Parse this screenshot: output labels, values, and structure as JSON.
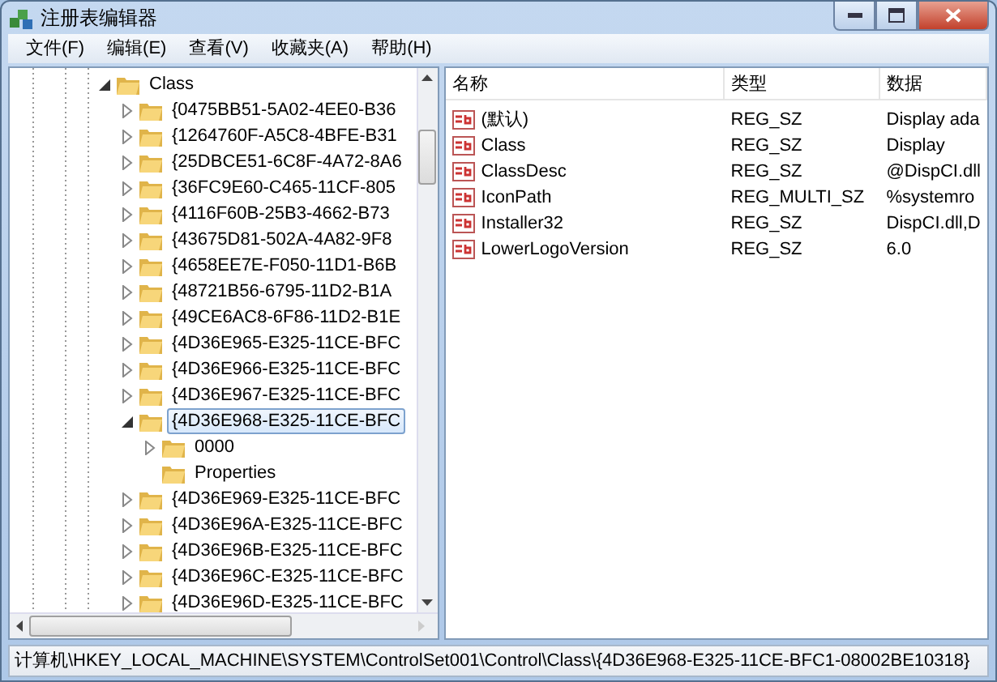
{
  "window": {
    "title": "注册表编辑器"
  },
  "menu": [
    {
      "label": "文件(F)"
    },
    {
      "label": "编辑(E)"
    },
    {
      "label": "查看(V)"
    },
    {
      "label": "收藏夹(A)"
    },
    {
      "label": "帮助(H)"
    }
  ],
  "tree": [
    {
      "label": "Class",
      "expanded": true,
      "selected": false,
      "children": [
        {
          "label": "{0475BB51-5A02-4EE0-B36",
          "expanded": false,
          "selected": false
        },
        {
          "label": "{1264760F-A5C8-4BFE-B31",
          "expanded": false,
          "selected": false
        },
        {
          "label": "{25DBCE51-6C8F-4A72-8A6",
          "expanded": false,
          "selected": false
        },
        {
          "label": "{36FC9E60-C465-11CF-805",
          "expanded": false,
          "selected": false
        },
        {
          "label": "{4116F60B-25B3-4662-B73",
          "expanded": false,
          "selected": false
        },
        {
          "label": "{43675D81-502A-4A82-9F8",
          "expanded": false,
          "selected": false
        },
        {
          "label": "{4658EE7E-F050-11D1-B6B",
          "expanded": false,
          "selected": false
        },
        {
          "label": "{48721B56-6795-11D2-B1A",
          "expanded": false,
          "selected": false
        },
        {
          "label": "{49CE6AC8-6F86-11D2-B1E",
          "expanded": false,
          "selected": false
        },
        {
          "label": "{4D36E965-E325-11CE-BFC",
          "expanded": false,
          "selected": false
        },
        {
          "label": "{4D36E966-E325-11CE-BFC",
          "expanded": false,
          "selected": false
        },
        {
          "label": "{4D36E967-E325-11CE-BFC",
          "expanded": false,
          "selected": false
        },
        {
          "label": "{4D36E968-E325-11CE-BFC",
          "expanded": true,
          "selected": true,
          "children": [
            {
              "label": "0000",
              "expanded": false,
              "selected": false
            },
            {
              "label": "Properties",
              "selected": false
            }
          ]
        },
        {
          "label": "{4D36E969-E325-11CE-BFC",
          "expanded": false,
          "selected": false
        },
        {
          "label": "{4D36E96A-E325-11CE-BFC",
          "expanded": false,
          "selected": false
        },
        {
          "label": "{4D36E96B-E325-11CE-BFC",
          "expanded": false,
          "selected": false
        },
        {
          "label": "{4D36E96C-E325-11CE-BFC",
          "expanded": false,
          "selected": false
        },
        {
          "label": "{4D36E96D-E325-11CE-BFC",
          "expanded": false,
          "selected": false
        }
      ]
    }
  ],
  "values": {
    "columns": [
      "名称",
      "类型",
      "数据"
    ],
    "rows": [
      {
        "name": "(默认)",
        "type": "REG_SZ",
        "data": "Display ada"
      },
      {
        "name": "Class",
        "type": "REG_SZ",
        "data": "Display"
      },
      {
        "name": "ClassDesc",
        "type": "REG_SZ",
        "data": "@DispCI.dll"
      },
      {
        "name": "IconPath",
        "type": "REG_MULTI_SZ",
        "data": "%systemro"
      },
      {
        "name": "Installer32",
        "type": "REG_SZ",
        "data": "DispCI.dll,D"
      },
      {
        "name": "LowerLogoVersion",
        "type": "REG_SZ",
        "data": "6.0"
      }
    ]
  },
  "status_bar": "计算机\\HKEY_LOCAL_MACHINE\\SYSTEM\\ControlSet001\\Control\\Class\\{4D36E968-E325-11CE-BFC1-08002BE10318}"
}
